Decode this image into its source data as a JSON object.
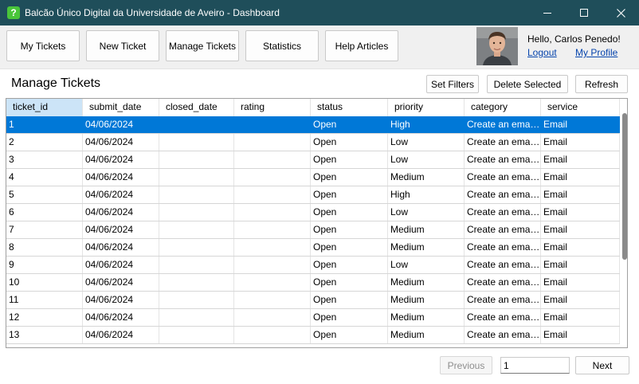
{
  "window": {
    "title": "Balcão Único Digital da Universidade de Aveiro - Dashboard",
    "app_icon": "question-icon",
    "app_icon_glyph": "?",
    "accent": "#1f4e5a"
  },
  "nav": {
    "items": [
      {
        "label": "My Tickets"
      },
      {
        "label": "New Ticket"
      },
      {
        "label": "Manage Tickets"
      },
      {
        "label": "Statistics"
      },
      {
        "label": "Help Articles"
      }
    ]
  },
  "user": {
    "greeting": "Hello, Carlos Penedo!",
    "logout_label": "Logout",
    "profile_label": "My Profile"
  },
  "page": {
    "title": "Manage Tickets",
    "actions": {
      "set_filters": "Set Filters",
      "delete_selected": "Delete Selected",
      "refresh": "Refresh"
    }
  },
  "table": {
    "columns": [
      "ticket_id",
      "submit_date",
      "closed_date",
      "rating",
      "status",
      "priority",
      "category",
      "service"
    ],
    "selected_row": 0,
    "selection_color": "#0078d7",
    "rows": [
      [
        "1",
        "04/06/2024",
        "",
        "",
        "Open",
        "High",
        "Create an email ...",
        "Email"
      ],
      [
        "2",
        "04/06/2024",
        "",
        "",
        "Open",
        "Low",
        "Create an email ...",
        "Email"
      ],
      [
        "3",
        "04/06/2024",
        "",
        "",
        "Open",
        "Low",
        "Create an email ...",
        "Email"
      ],
      [
        "4",
        "04/06/2024",
        "",
        "",
        "Open",
        "Medium",
        "Create an email ...",
        "Email"
      ],
      [
        "5",
        "04/06/2024",
        "",
        "",
        "Open",
        "High",
        "Create an email ...",
        "Email"
      ],
      [
        "6",
        "04/06/2024",
        "",
        "",
        "Open",
        "Low",
        "Create an email ...",
        "Email"
      ],
      [
        "7",
        "04/06/2024",
        "",
        "",
        "Open",
        "Medium",
        "Create an email ...",
        "Email"
      ],
      [
        "8",
        "04/06/2024",
        "",
        "",
        "Open",
        "Medium",
        "Create an email ...",
        "Email"
      ],
      [
        "9",
        "04/06/2024",
        "",
        "",
        "Open",
        "Low",
        "Create an email ...",
        "Email"
      ],
      [
        "10",
        "04/06/2024",
        "",
        "",
        "Open",
        "Medium",
        "Create an email ...",
        "Email"
      ],
      [
        "11",
        "04/06/2024",
        "",
        "",
        "Open",
        "Medium",
        "Create an email ...",
        "Email"
      ],
      [
        "12",
        "04/06/2024",
        "",
        "",
        "Open",
        "Medium",
        "Create an email ...",
        "Email"
      ],
      [
        "13",
        "04/06/2024",
        "",
        "",
        "Open",
        "Medium",
        "Create an email ...",
        "Email"
      ]
    ]
  },
  "pagination": {
    "previous_label": "Previous",
    "page_value": "1",
    "next_label": "Next"
  }
}
